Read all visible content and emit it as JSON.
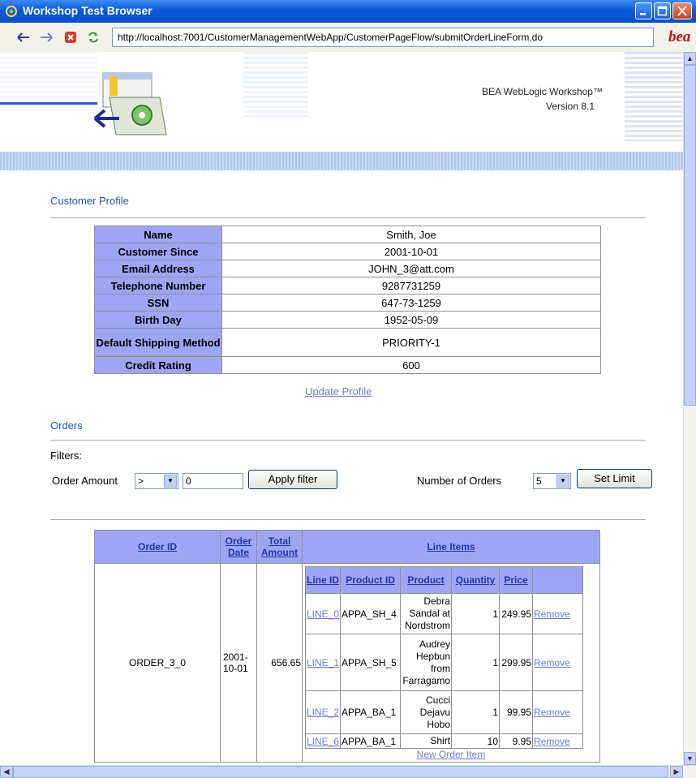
{
  "window": {
    "title": "Workshop Test Browser"
  },
  "toolbar": {
    "url": "http://localhost:7001/CustomerManagementWebApp/CustomerPageFlow/submitOrderLineForm.do",
    "logo_text": "bea"
  },
  "banner": {
    "product": "BEA WebLogic Workshop™",
    "version": "Version 8.1"
  },
  "profile": {
    "title": "Customer Profile",
    "rows": [
      {
        "label": "Name",
        "value": "Smith, Joe"
      },
      {
        "label": "Customer Since",
        "value": "2001-10-01"
      },
      {
        "label": "Email Address",
        "value": "JOHN_3@att.com"
      },
      {
        "label": "Telephone Number",
        "value": "9287731259"
      },
      {
        "label": "SSN",
        "value": "647-73-1259"
      },
      {
        "label": "Birth Day",
        "value": "1952-05-09"
      },
      {
        "label": "Default Shipping Method",
        "value": "PRIORITY-1"
      },
      {
        "label": "Credit Rating",
        "value": "600"
      }
    ],
    "update_link": "Update Profile"
  },
  "orders": {
    "title": "Orders",
    "filters_label": "Filters:",
    "order_amount_label": "Order Amount",
    "operator": ">",
    "amount_value": "0",
    "apply_button": "Apply filter",
    "num_orders_label": "Number of Orders",
    "num_orders": "5",
    "set_limit_button": "Set Limit",
    "headers": {
      "order_id": "Order ID",
      "order_date": "Order Date",
      "total_amount": "Total Amount",
      "line_items": "Line Items"
    },
    "line_headers": {
      "line_id": "Line ID",
      "product_id": "Product ID",
      "product": "Product",
      "quantity": "Quantity",
      "price": "Price"
    },
    "order": {
      "id": "ORDER_3_0",
      "date": "2001-10-01",
      "total": "656.65",
      "lines": [
        {
          "line_id": "LINE_0",
          "product_id": "APPA_SH_4",
          "product": "Debra Sandal at Nordstrom",
          "quantity": "1",
          "price": "249.95",
          "remove": "Remove"
        },
        {
          "line_id": "LINE_1",
          "product_id": "APPA_SH_5",
          "product": "Audrey Hepbun from Farragamo",
          "quantity": "1",
          "price": "299.95",
          "remove": "Remove"
        },
        {
          "line_id": "LINE_2",
          "product_id": "APPA_BA_1",
          "product": "Cucci Dejavu Hobo",
          "quantity": "1",
          "price": "99.95",
          "remove": "Remove"
        },
        {
          "line_id": "LINE_6",
          "product_id": "APPA_BA_1",
          "product": "Shirt",
          "quantity": "10",
          "price": "9.95",
          "remove": "Remove"
        }
      ],
      "new_item": "New Order Item"
    }
  }
}
